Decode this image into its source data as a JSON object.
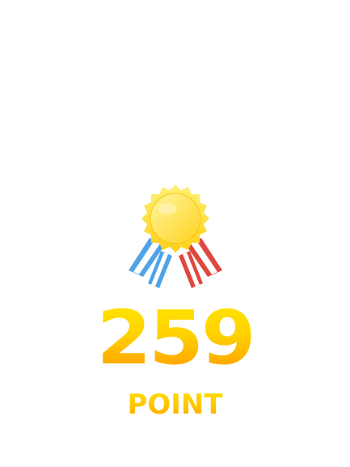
{
  "result": {
    "score": "259",
    "unit_label": "POINT"
  },
  "medal": {
    "icon": "gold-medal-with-ribbons-icon",
    "colors": {
      "gold_light": "#ffe955",
      "gold_dark": "#ffcf1a",
      "ribbon_blue": "#4fa3e6",
      "ribbon_red": "#e0473f",
      "ribbon_white": "#ffffff"
    }
  },
  "colors": {
    "background": "#ffffff",
    "score_top": "#ffe800",
    "score_bottom": "#ff9a00"
  }
}
